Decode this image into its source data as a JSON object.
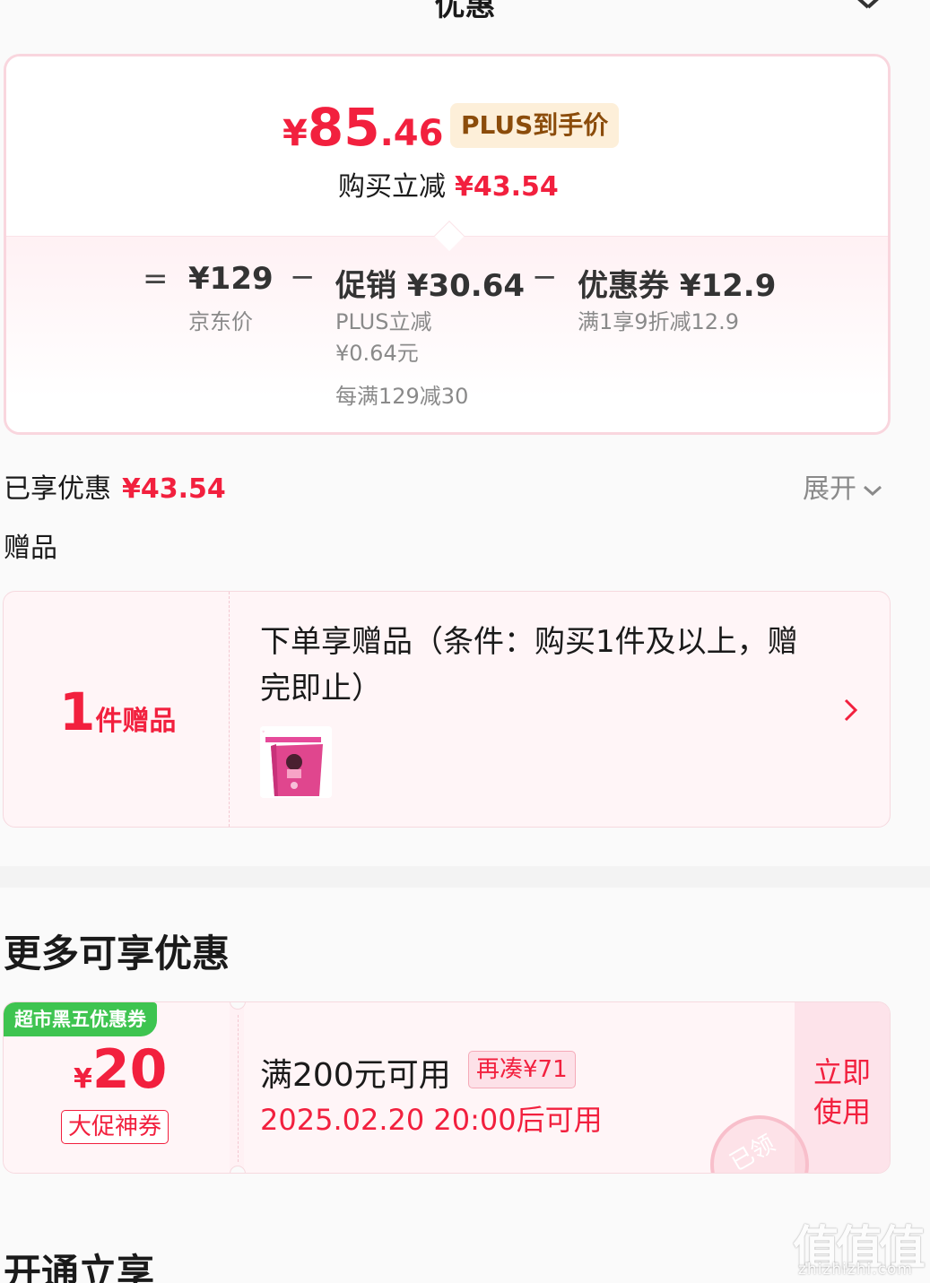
{
  "header": {
    "title": "优惠"
  },
  "price_card": {
    "final_price": {
      "yen": "¥",
      "int": "85",
      "dec": ".46"
    },
    "badge": "PLUS到手价",
    "buy_reduce_label": "购买立减",
    "buy_reduce_amount": "¥43.54",
    "equals": "=",
    "minus": "−",
    "jd_price": {
      "value": "¥129",
      "label": "京东价"
    },
    "promo": {
      "value": "促销 ¥30.64",
      "sub1": "PLUS立减",
      "sub2": "¥0.64元",
      "sub3": "每满129减30"
    },
    "coupon": {
      "value": "优惠券 ¥12.9",
      "sub1": "满1享9折减12.9"
    }
  },
  "enjoyed": {
    "label": "已享优惠",
    "amount": "¥43.54",
    "expand": "展开"
  },
  "gifts": {
    "label": "赠品",
    "count": "1",
    "count_unit": "件赠品",
    "description": "下单享赠品（条件：购买1件及以上，赠完即止）"
  },
  "more": {
    "title": "更多可享优惠",
    "coupon": {
      "tag": "超市黑五优惠券",
      "yen": "¥",
      "value": "20",
      "kind": "大促神券",
      "condition": "满200元可用",
      "gap": "再凑¥71",
      "time": "2025.02.20 20:00后可用",
      "action": "立即使用",
      "stamp": "已领"
    }
  },
  "open_title": "开通立享",
  "watermark": {
    "big": "值值值",
    "small": "zhizhizhi.com"
  },
  "icons": {
    "close": "close-icon",
    "expand": "chevron-down-icon",
    "gift_arrow": "chevron-right-icon"
  },
  "colors": {
    "accent": "#f2203e",
    "plus_badge_bg": "#fdefd9",
    "plus_badge_text": "#8b4c0b",
    "coupon_tag": "#3ec450"
  }
}
